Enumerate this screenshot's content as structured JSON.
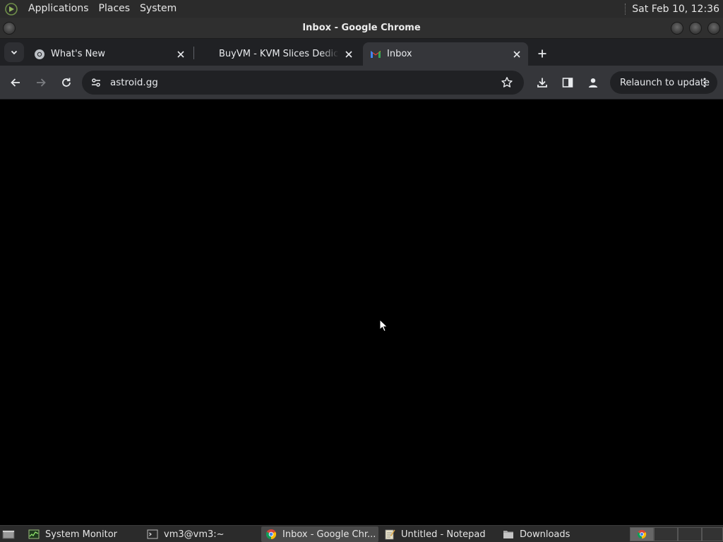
{
  "top_panel": {
    "menus": [
      "Applications",
      "Places",
      "System"
    ],
    "clock": "Sat Feb 10, 12:36"
  },
  "window": {
    "title": "Inbox - Google Chrome"
  },
  "tabs": [
    {
      "title": "What's New",
      "icon": "chrome-icon",
      "active": false
    },
    {
      "title": "BuyVM - KVM Slices Dedicated",
      "icon": "none",
      "active": false
    },
    {
      "title": "Inbox",
      "icon": "gmail-icon",
      "active": true
    }
  ],
  "toolbar": {
    "url": "astroid.gg",
    "relaunch_label": "Relaunch to update"
  },
  "taskbar": {
    "tasks": [
      {
        "label": "System Monitor",
        "icon": "system-monitor-icon",
        "active": false
      },
      {
        "label": "vm3@vm3:~",
        "icon": "terminal-icon",
        "active": false
      },
      {
        "label": "Inbox - Google Chr...",
        "icon": "chrome-icon",
        "active": true
      },
      {
        "label": "Untitled - Notepad",
        "icon": "notepad-icon",
        "active": false
      },
      {
        "label": "Downloads",
        "icon": "folder-icon",
        "active": false
      }
    ]
  },
  "colors": {
    "panel": "#2b2b2b",
    "tabstrip": "#202124",
    "toolbar": "#35363a",
    "content": "#000000"
  }
}
